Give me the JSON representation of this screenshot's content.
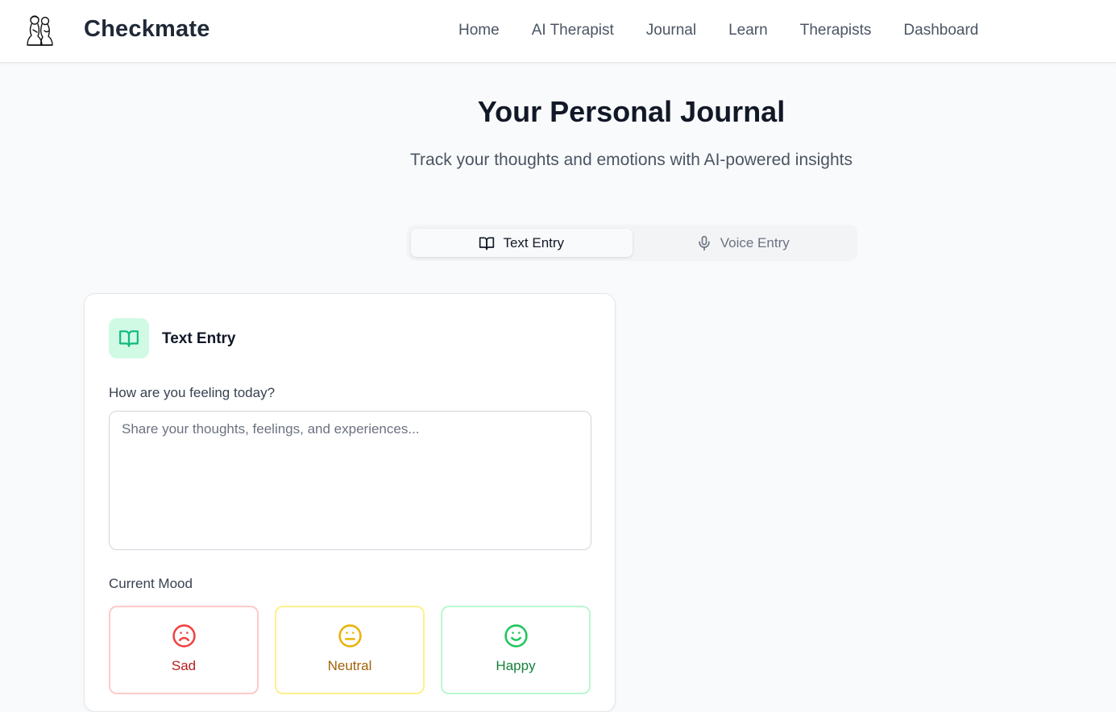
{
  "header": {
    "brand": "Checkmate",
    "logo_icon": "chess-figures-logo-icon",
    "nav": [
      {
        "label": "Home"
      },
      {
        "label": "AI Therapist"
      },
      {
        "label": "Journal"
      },
      {
        "label": "Learn"
      },
      {
        "label": "Therapists"
      },
      {
        "label": "Dashboard"
      }
    ]
  },
  "hero": {
    "title": "Your Personal Journal",
    "subtitle": "Track your thoughts and emotions with AI-powered insights"
  },
  "tabs": [
    {
      "label": "Text Entry",
      "icon": "book-open-icon",
      "active": true
    },
    {
      "label": "Voice Entry",
      "icon": "microphone-icon",
      "active": false
    }
  ],
  "card": {
    "title": "Text Entry",
    "icon": "book-open-icon",
    "icon_bg": "#d1fae5",
    "icon_color": "#10b981",
    "prompt_label": "How are you feeling today?",
    "textarea_value": "",
    "textarea_placeholder": "Share your thoughts, feelings, and experiences...",
    "mood_label": "Current Mood",
    "moods": [
      {
        "label": "Sad",
        "icon": "frown-icon",
        "color": "#ef4444"
      },
      {
        "label": "Neutral",
        "icon": "meh-icon",
        "color": "#eab308"
      },
      {
        "label": "Happy",
        "icon": "smile-icon",
        "color": "#22c55e"
      }
    ]
  }
}
